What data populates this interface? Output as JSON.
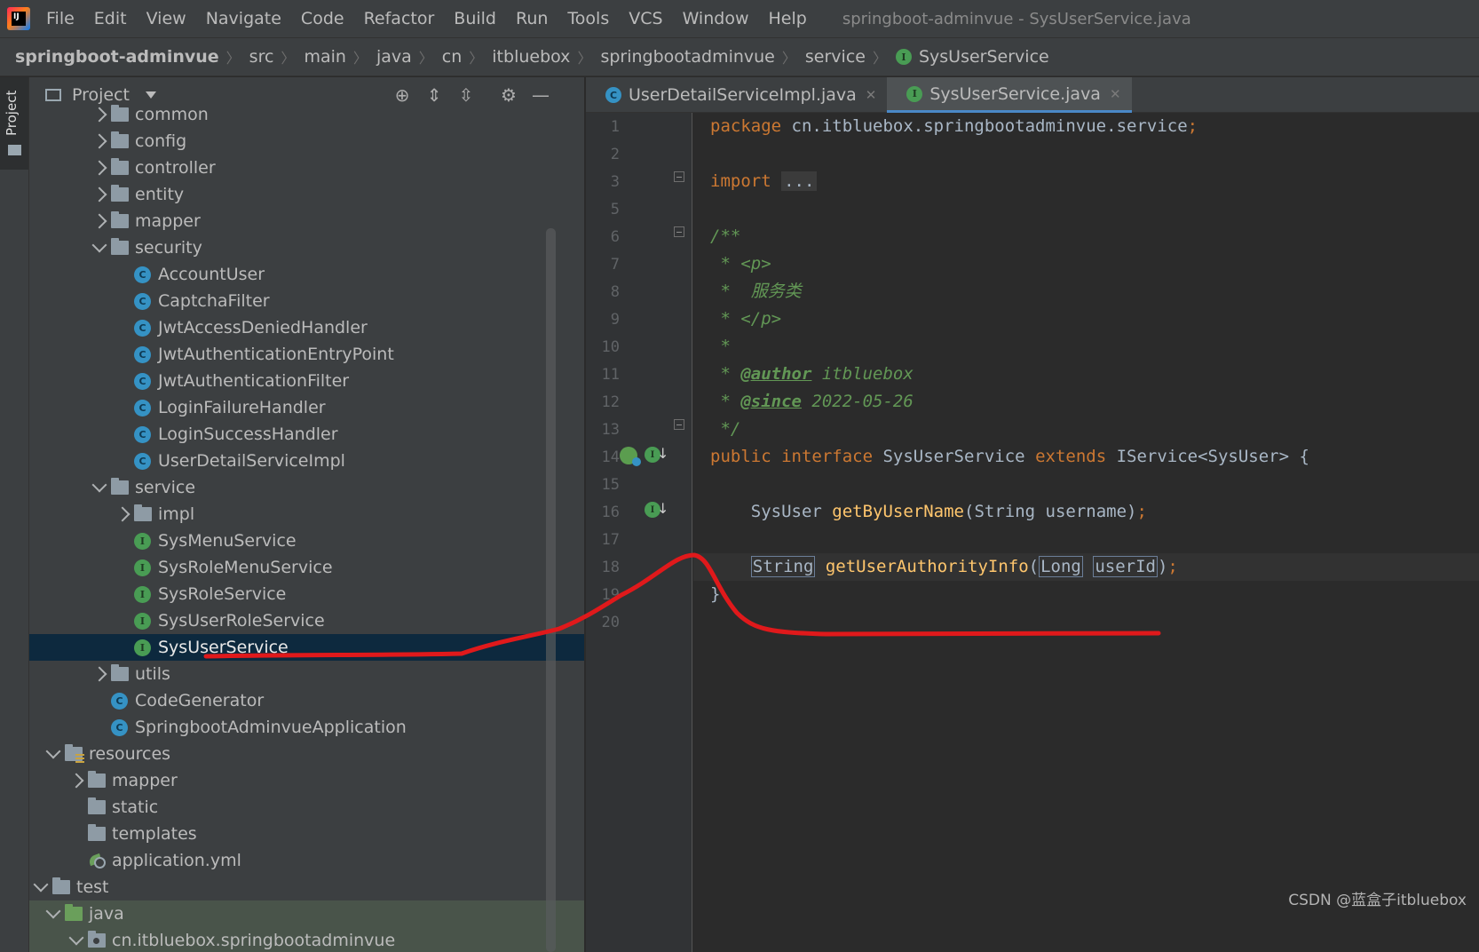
{
  "app": {
    "logo_text": "IJ",
    "window_title": "springboot-adminvue - SysUserService.java"
  },
  "menu": [
    "File",
    "Edit",
    "View",
    "Navigate",
    "Code",
    "Refactor",
    "Build",
    "Run",
    "Tools",
    "VCS",
    "Window",
    "Help"
  ],
  "breadcrumb": [
    "springboot-adminvue",
    "src",
    "main",
    "java",
    "cn",
    "itbluebox",
    "springbootadminvue",
    "service",
    "SysUserService"
  ],
  "tool_stripe": {
    "project_label": "Project"
  },
  "project_panel": {
    "title": "Project",
    "tree": [
      {
        "label": "common",
        "kind": "folder",
        "chevron": "right",
        "depth": 5
      },
      {
        "label": "config",
        "kind": "folder",
        "chevron": "right",
        "depth": 5
      },
      {
        "label": "controller",
        "kind": "folder",
        "chevron": "right",
        "depth": 5
      },
      {
        "label": "entity",
        "kind": "folder",
        "chevron": "right",
        "depth": 5
      },
      {
        "label": "mapper",
        "kind": "folder",
        "chevron": "right",
        "depth": 5
      },
      {
        "label": "security",
        "kind": "folder",
        "chevron": "down",
        "depth": 5
      },
      {
        "label": "AccountUser",
        "kind": "class",
        "depth": 6
      },
      {
        "label": "CaptchaFilter",
        "kind": "class",
        "depth": 6
      },
      {
        "label": "JwtAccessDeniedHandler",
        "kind": "class",
        "depth": 6
      },
      {
        "label": "JwtAuthenticationEntryPoint",
        "kind": "class",
        "depth": 6
      },
      {
        "label": "JwtAuthenticationFilter",
        "kind": "class",
        "depth": 6
      },
      {
        "label": "LoginFailureHandler",
        "kind": "class",
        "depth": 6
      },
      {
        "label": "LoginSuccessHandler",
        "kind": "class",
        "depth": 6
      },
      {
        "label": "UserDetailServiceImpl",
        "kind": "class",
        "depth": 6
      },
      {
        "label": "service",
        "kind": "folder",
        "chevron": "down",
        "depth": 5
      },
      {
        "label": "impl",
        "kind": "folder",
        "chevron": "right",
        "depth": 6
      },
      {
        "label": "SysMenuService",
        "kind": "interface",
        "depth": 6
      },
      {
        "label": "SysRoleMenuService",
        "kind": "interface",
        "depth": 6
      },
      {
        "label": "SysRoleService",
        "kind": "interface",
        "depth": 6
      },
      {
        "label": "SysUserRoleService",
        "kind": "interface",
        "depth": 6
      },
      {
        "label": "SysUserService",
        "kind": "interface",
        "depth": 6,
        "selected": true
      },
      {
        "label": "utils",
        "kind": "folder",
        "chevron": "right",
        "depth": 5
      },
      {
        "label": "CodeGenerator",
        "kind": "class",
        "depth": 5
      },
      {
        "label": "SpringbootAdminvueApplication",
        "kind": "class",
        "depth": 5
      },
      {
        "label": "resources",
        "kind": "resources",
        "chevron": "down",
        "depth": 3
      },
      {
        "label": "mapper",
        "kind": "folder",
        "chevron": "right",
        "depth": 4
      },
      {
        "label": "static",
        "kind": "folder",
        "depth": 4
      },
      {
        "label": "templates",
        "kind": "folder",
        "depth": 4
      },
      {
        "label": "application.yml",
        "kind": "yml",
        "depth": 4
      },
      {
        "label": "test",
        "kind": "folder",
        "chevron": "down",
        "depth": 2
      },
      {
        "label": "java",
        "kind": "folder-green",
        "chevron": "down",
        "depth": 3,
        "test_bg": true
      },
      {
        "label": "cn.itbluebox.springbootadminvue",
        "kind": "package",
        "chevron": "down",
        "depth": 4,
        "test_bg": true
      }
    ]
  },
  "editor": {
    "tabs": [
      {
        "label": "UserDetailServiceImpl.java",
        "kind": "class",
        "active": false
      },
      {
        "label": "SysUserService.java",
        "kind": "interface",
        "active": true
      }
    ],
    "line_numbers": [
      "1",
      "2",
      "3",
      "5",
      "6",
      "7",
      "8",
      "9",
      "10",
      "11",
      "12",
      "13",
      "14",
      "15",
      "16",
      "17",
      "18",
      "19",
      "20"
    ],
    "code": {
      "l1_kw": "package",
      "l1_rest": " cn.itbluebox.springbootadminvue.service",
      "l3_kw": "import",
      "l3_folded": "...",
      "l6": "/**",
      "l7": " * <p>",
      "l8": " *  服务类",
      "l9": " * </p>",
      "l10": " *",
      "l11_pre": " * ",
      "l11_tag": "@author",
      "l11_val": " itbluebox",
      "l12_pre": " * ",
      "l12_tag": "@since",
      "l12_val": " 2022-05-26",
      "l13": " */",
      "l14_kw1": "public interface",
      "l14_name": " SysUserService ",
      "l14_kw2": "extends",
      "l14_rest": " IService<SysUser> {",
      "l16_type": "SysUser ",
      "l16_fn": "getByUserName",
      "l16_rest": "(String username)",
      "l18_type": "String",
      "l18_fn": "getUserAuthorityInfo",
      "l18_paren": "(",
      "l18_ptype": "Long",
      "l18_pname": "userId",
      "l18_close": ")",
      "semicolon": ";",
      "l19": "}"
    }
  },
  "watermark": "CSDN @蓝盒子itbluebox",
  "colors": {
    "annotation_stroke": "#e0191b",
    "selection": "#0d293e",
    "keyword": "#cc7832",
    "function": "#ffc66d",
    "doc_comment": "#629755"
  }
}
